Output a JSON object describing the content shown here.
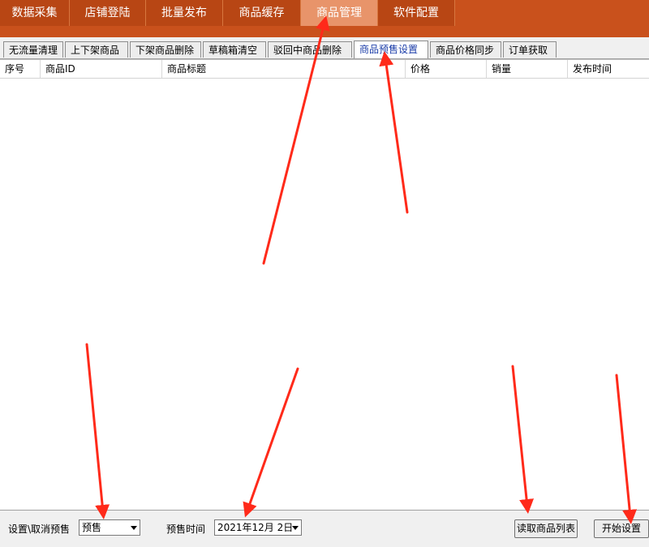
{
  "nav": {
    "items": [
      "数据采集",
      "店铺登陆",
      "批量发布",
      "商品缓存",
      "商品管理",
      "软件配置"
    ],
    "active_index": 4
  },
  "tabs": {
    "items": [
      "无流量清理",
      "上下架商品",
      "下架商品删除",
      "草稿箱清空",
      "驳回中商品删除",
      "商品预售设置",
      "商品价格同步",
      "订单获取"
    ],
    "active_index": 5
  },
  "table": {
    "columns": [
      "序号",
      "商品ID",
      "商品标题",
      "价格",
      "销量",
      "发布时间"
    ],
    "rows": []
  },
  "bottom": {
    "presale_label": "设置\\取消预售",
    "presale_value": "预售",
    "presale_time_label": "预售时间",
    "presale_time_value": "2021年12月 2日",
    "read_list_button": "读取商品列表",
    "start_button": "开始设置"
  },
  "colors": {
    "nav_bar": "#c9511c",
    "nav_item": "#b84614",
    "nav_active": "#e8946a",
    "active_tab_text": "#1a3ca8",
    "annotation_arrow": "#ff2a1a"
  }
}
